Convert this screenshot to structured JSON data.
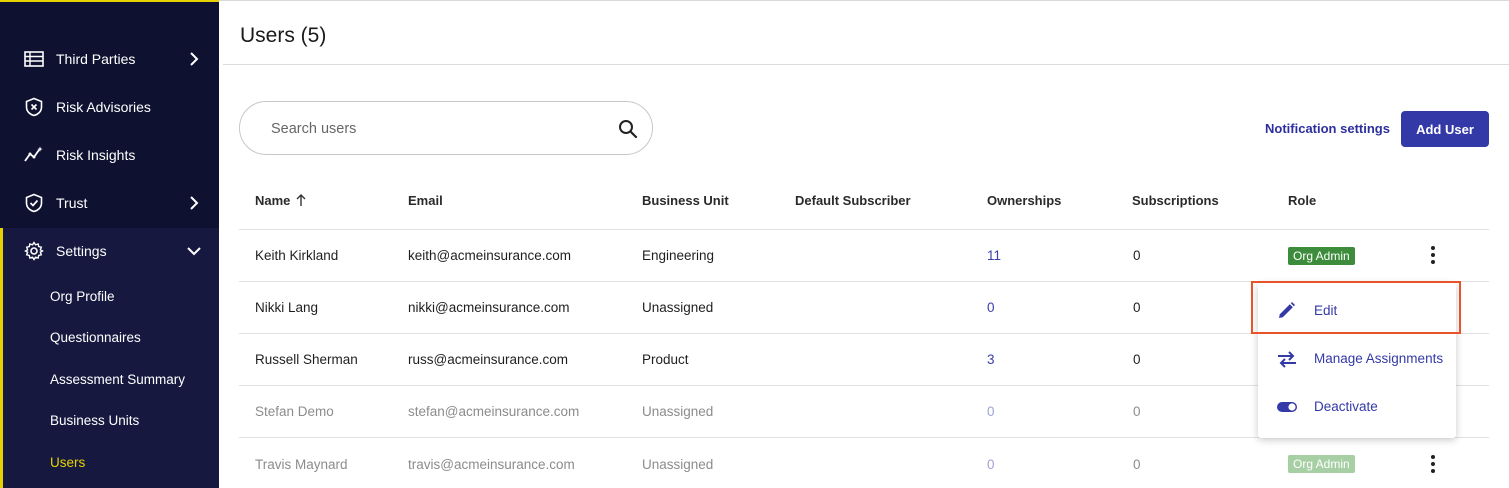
{
  "sidebar": {
    "items": [
      {
        "label": "Third Parties",
        "icon": "list-icon",
        "chevron": "right"
      },
      {
        "label": "Risk Advisories",
        "icon": "shield-x-icon",
        "chevron": null
      },
      {
        "label": "Risk Insights",
        "icon": "trend-icon",
        "chevron": null
      },
      {
        "label": "Trust",
        "icon": "shield-check-icon",
        "chevron": "right"
      },
      {
        "label": "Settings",
        "icon": "gear-icon",
        "chevron": "down"
      }
    ],
    "settings_subitems": [
      {
        "label": "Org Profile"
      },
      {
        "label": "Questionnaires"
      },
      {
        "label": "Assessment Summary"
      },
      {
        "label": "Business Units"
      },
      {
        "label": "Users",
        "active": true
      }
    ],
    "accent_color": "#e6d200"
  },
  "page": {
    "title": "Users (5)"
  },
  "search": {
    "placeholder": "Search users",
    "value": ""
  },
  "actions": {
    "notification_settings": "Notification settings",
    "add_user": "Add User"
  },
  "table": {
    "columns": [
      "Name",
      "Email",
      "Business Unit",
      "Default Subscriber",
      "Ownerships",
      "Subscriptions",
      "Role"
    ],
    "sort": {
      "column": "Name",
      "direction": "asc"
    },
    "rows": [
      {
        "name": "Keith Kirkland",
        "email": "keith@acmeinsurance.com",
        "business_unit": "Engineering",
        "default_subscriber": "",
        "ownerships": "11",
        "subscriptions": "0",
        "role": "Org Admin",
        "active": true
      },
      {
        "name": "Nikki Lang",
        "email": "nikki@acmeinsurance.com",
        "business_unit": "Unassigned",
        "default_subscriber": "",
        "ownerships": "0",
        "subscriptions": "0",
        "role": "",
        "active": true
      },
      {
        "name": "Russell Sherman",
        "email": "russ@acmeinsurance.com",
        "business_unit": "Product",
        "default_subscriber": "",
        "ownerships": "3",
        "subscriptions": "0",
        "role": "",
        "active": true
      },
      {
        "name": "Stefan Demo",
        "email": "stefan@acmeinsurance.com",
        "business_unit": "Unassigned",
        "default_subscriber": "",
        "ownerships": "0",
        "subscriptions": "0",
        "role": "",
        "active": false
      },
      {
        "name": "Travis Maynard",
        "email": "travis@acmeinsurance.com",
        "business_unit": "Unassigned",
        "default_subscriber": "",
        "ownerships": "0",
        "subscriptions": "0",
        "role": "Org Admin",
        "active": false
      }
    ]
  },
  "row_menu": {
    "items": [
      {
        "label": "Edit",
        "icon": "pencil-icon"
      },
      {
        "label": "Manage Assignments",
        "icon": "swap-arrows-icon"
      },
      {
        "label": "Deactivate",
        "icon": "toggle-icon"
      }
    ]
  },
  "colors": {
    "primary": "#3439a8",
    "badge": "#3d8c3b",
    "highlight": "#e8532a"
  }
}
